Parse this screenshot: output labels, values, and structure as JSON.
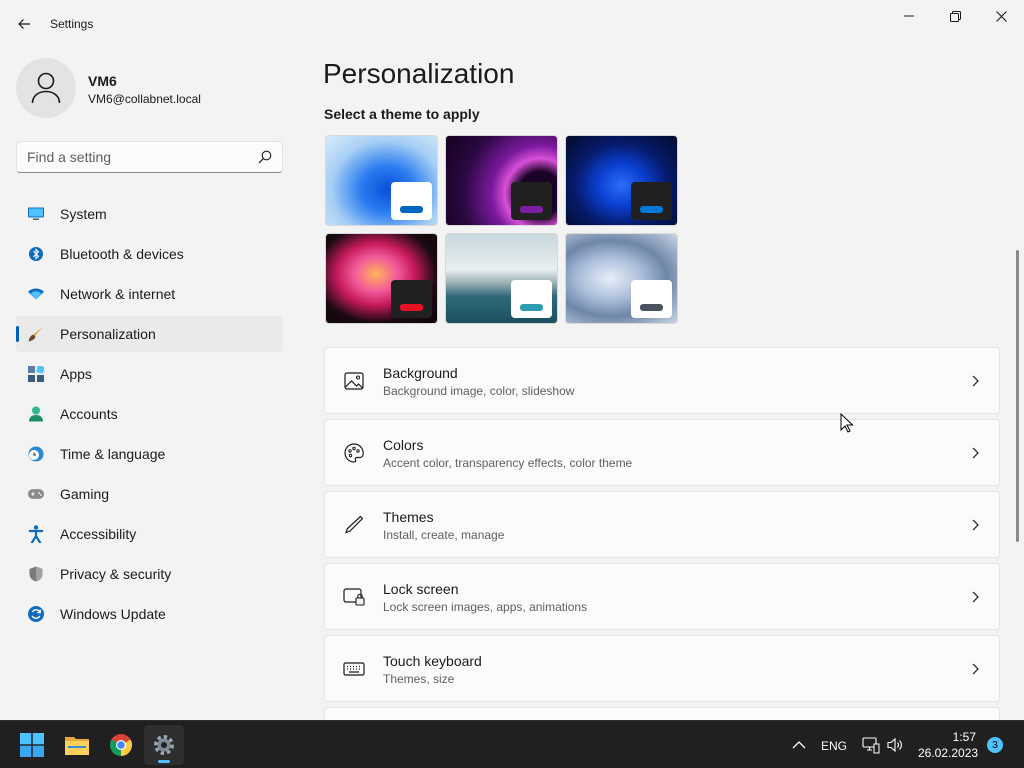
{
  "window": {
    "title": "Settings"
  },
  "profile": {
    "name": "VM6",
    "email": "VM6@collabnet.local"
  },
  "search": {
    "placeholder": "Find a setting"
  },
  "sidebar": {
    "items": [
      {
        "label": "System",
        "icon": "monitor-icon"
      },
      {
        "label": "Bluetooth & devices",
        "icon": "bluetooth-icon"
      },
      {
        "label": "Network & internet",
        "icon": "wifi-icon"
      },
      {
        "label": "Personalization",
        "icon": "brush-icon",
        "active": true
      },
      {
        "label": "Apps",
        "icon": "apps-icon"
      },
      {
        "label": "Accounts",
        "icon": "person-icon"
      },
      {
        "label": "Time & language",
        "icon": "clock-globe-icon"
      },
      {
        "label": "Gaming",
        "icon": "gamepad-icon"
      },
      {
        "label": "Accessibility",
        "icon": "accessibility-icon"
      },
      {
        "label": "Privacy & security",
        "icon": "shield-icon"
      },
      {
        "label": "Windows Update",
        "icon": "update-icon"
      }
    ]
  },
  "main": {
    "title": "Personalization",
    "theme_heading": "Select a theme to apply",
    "themes": [
      {
        "accent": "#0067c0"
      },
      {
        "accent": "#7a1fa2"
      },
      {
        "accent": "#0078d4"
      },
      {
        "accent": "#e81123"
      },
      {
        "accent": "#2d9cb0"
      },
      {
        "accent": "#4a5460"
      }
    ],
    "settings": [
      {
        "title": "Background",
        "subtitle": "Background image, color, slideshow",
        "icon": "image-icon"
      },
      {
        "title": "Colors",
        "subtitle": "Accent color, transparency effects, color theme",
        "icon": "palette-icon"
      },
      {
        "title": "Themes",
        "subtitle": "Install, create, manage",
        "icon": "pen-icon"
      },
      {
        "title": "Lock screen",
        "subtitle": "Lock screen images, apps, animations",
        "icon": "lock-screen-icon"
      },
      {
        "title": "Touch keyboard",
        "subtitle": "Themes, size",
        "icon": "keyboard-icon"
      }
    ]
  },
  "taskbar": {
    "apps": [
      "start-icon",
      "file-explorer-icon",
      "chrome-icon",
      "settings-icon"
    ],
    "language": "ENG",
    "time": "1:57",
    "date": "26.02.2023",
    "notifications": "3"
  },
  "colors": {
    "accent": "#005fb8",
    "taskbar": "#202020",
    "background": "#f3f3f3"
  }
}
